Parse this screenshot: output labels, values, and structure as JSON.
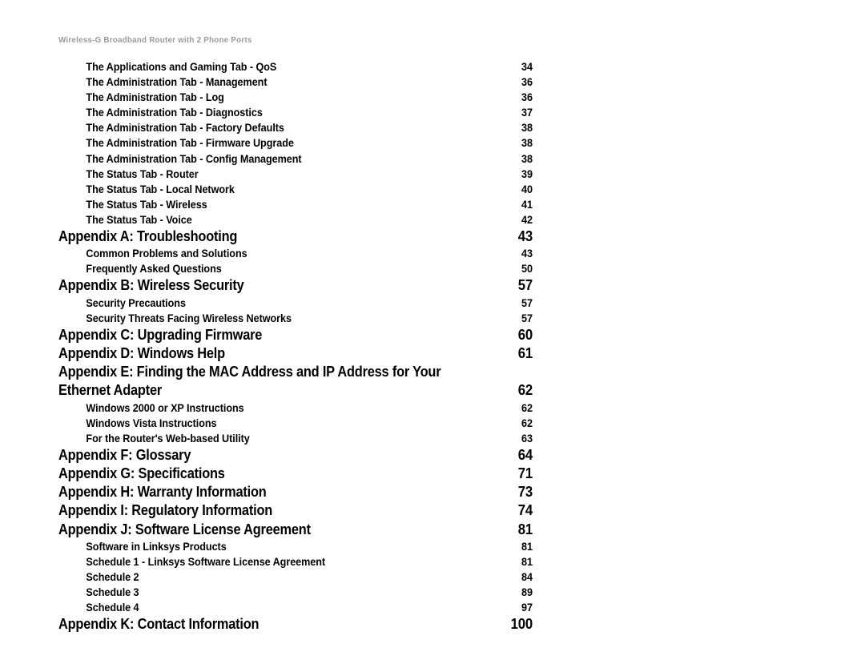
{
  "header": {
    "running_title": "Wireless-G Broadband Router with 2 Phone Ports"
  },
  "colors": {
    "header_gray": "#9b9b9b",
    "text_black": "#000000",
    "page_background": "#ffffff"
  },
  "toc": {
    "entries": [
      {
        "level": "sub",
        "label": "The Applications and Gaming Tab - QoS",
        "page": "34"
      },
      {
        "level": "sub",
        "label": "The Administration Tab - Management",
        "page": "36"
      },
      {
        "level": "sub",
        "label": "The Administration Tab - Log",
        "page": "36"
      },
      {
        "level": "sub",
        "label": "The Administration Tab - Diagnostics",
        "page": "37"
      },
      {
        "level": "sub",
        "label": "The Administration Tab - Factory Defaults",
        "page": "38"
      },
      {
        "level": "sub",
        "label": "The Administration Tab - Firmware Upgrade",
        "page": "38"
      },
      {
        "level": "sub",
        "label": "The Administration Tab - Config Management",
        "page": "38"
      },
      {
        "level": "sub",
        "label": "The Status Tab - Router",
        "page": "39"
      },
      {
        "level": "sub",
        "label": "The Status Tab - Local Network",
        "page": "40"
      },
      {
        "level": "sub",
        "label": "The Status Tab - Wireless",
        "page": "41"
      },
      {
        "level": "sub",
        "label": "The Status Tab - Voice",
        "page": "42"
      },
      {
        "level": "appendix",
        "label": "Appendix A: Troubleshooting",
        "page": "43"
      },
      {
        "level": "sub",
        "label": "Common Problems and Solutions",
        "page": "43"
      },
      {
        "level": "sub",
        "label": "Frequently Asked Questions",
        "page": "50"
      },
      {
        "level": "appendix",
        "label": "Appendix B: Wireless Security",
        "page": "57"
      },
      {
        "level": "sub",
        "label": "Security Precautions",
        "page": "57"
      },
      {
        "level": "sub",
        "label": "Security Threats Facing Wireless Networks",
        "page": "57"
      },
      {
        "level": "appendix",
        "label": "Appendix C: Upgrading Firmware",
        "page": "60"
      },
      {
        "level": "appendix",
        "label": "Appendix D: Windows Help",
        "page": "61"
      },
      {
        "level": "appendix-wrap",
        "label": "Appendix E: Finding the MAC Address and IP Address for Your",
        "page": ""
      },
      {
        "level": "appendix",
        "label": "Ethernet Adapter",
        "page": "62"
      },
      {
        "level": "sub",
        "label": "Windows 2000 or XP Instructions",
        "page": "62"
      },
      {
        "level": "sub",
        "label": "Windows Vista Instructions",
        "page": "62"
      },
      {
        "level": "sub",
        "label": "For the Router's Web-based Utility",
        "page": "63"
      },
      {
        "level": "appendix",
        "label": "Appendix F: Glossary",
        "page": "64"
      },
      {
        "level": "appendix",
        "label": "Appendix G: Specifications",
        "page": "71"
      },
      {
        "level": "appendix",
        "label": "Appendix H: Warranty Information",
        "page": "73"
      },
      {
        "level": "appendix",
        "label": "Appendix I: Regulatory Information",
        "page": "74"
      },
      {
        "level": "appendix",
        "label": "Appendix J: Software License Agreement",
        "page": "81"
      },
      {
        "level": "sub",
        "label": "Software in Linksys Products",
        "page": "81"
      },
      {
        "level": "sub",
        "label": "Schedule 1 - Linksys Software License Agreement",
        "page": "81"
      },
      {
        "level": "sub",
        "label": "Schedule 2",
        "page": "84"
      },
      {
        "level": "sub",
        "label": "Schedule 3",
        "page": "89"
      },
      {
        "level": "sub",
        "label": "Schedule 4",
        "page": "97"
      },
      {
        "level": "appendix",
        "label": "Appendix K: Contact Information",
        "page": "100"
      }
    ]
  }
}
